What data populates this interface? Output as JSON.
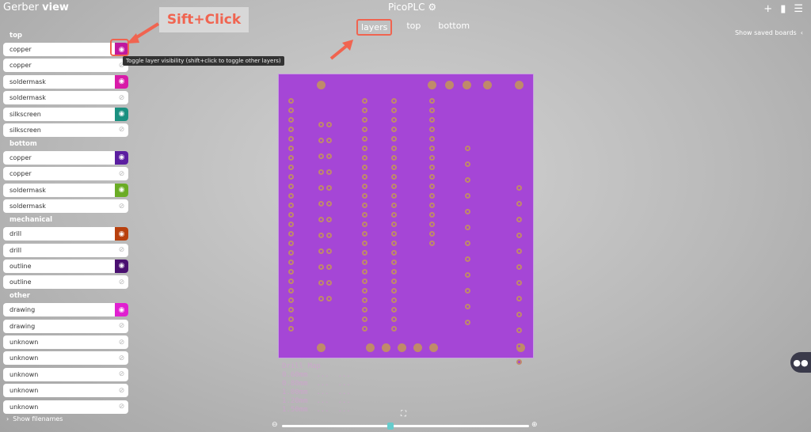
{
  "app": {
    "title_light": "Gerber",
    "title_bold": "view",
    "board_name": "PicoPLC"
  },
  "tabs": [
    {
      "label": "layers",
      "active": true
    },
    {
      "label": "top"
    },
    {
      "label": "bottom"
    }
  ],
  "header": {
    "saved_boards": "Show saved boards"
  },
  "sidebar": {
    "groups": [
      {
        "label": "top",
        "layers": [
          {
            "name": "copper",
            "visible": true,
            "color": "#c0179f"
          },
          {
            "name": "copper",
            "visible": false
          },
          {
            "name": "soldermask",
            "visible": true,
            "color": "#d81ba8"
          },
          {
            "name": "soldermask",
            "visible": false
          },
          {
            "name": "silkscreen",
            "visible": true,
            "color": "#1a9080"
          },
          {
            "name": "silkscreen",
            "visible": false
          }
        ]
      },
      {
        "label": "bottom",
        "layers": [
          {
            "name": "copper",
            "visible": true,
            "color": "#5b1ea0"
          },
          {
            "name": "copper",
            "visible": false
          },
          {
            "name": "soldermask",
            "visible": true,
            "color": "#6aac24"
          },
          {
            "name": "soldermask",
            "visible": false
          }
        ]
      },
      {
        "label": "mechanical",
        "layers": [
          {
            "name": "drill",
            "visible": true,
            "color": "#b8400e"
          },
          {
            "name": "drill",
            "visible": false
          },
          {
            "name": "outline",
            "visible": true,
            "color": "#4a1070"
          },
          {
            "name": "outline",
            "visible": false
          }
        ]
      },
      {
        "label": "other",
        "layers": [
          {
            "name": "drawing",
            "visible": true,
            "color": "#e020d0"
          },
          {
            "name": "drawing",
            "visible": false
          },
          {
            "name": "unknown",
            "visible": false
          },
          {
            "name": "unknown",
            "visible": false
          },
          {
            "name": "unknown",
            "visible": false
          },
          {
            "name": "unknown",
            "visible": false
          },
          {
            "name": "unknown",
            "visible": false
          }
        ]
      }
    ],
    "show_filenames": "Show filenames"
  },
  "tooltip": "Toggle layer visibility (shift+click to toggle other layers)",
  "annotation": "Sift+Click",
  "zoom": {
    "level_fraction": 0.44
  },
  "colors": {
    "accent": "#f06450",
    "board": "#a546d6"
  }
}
